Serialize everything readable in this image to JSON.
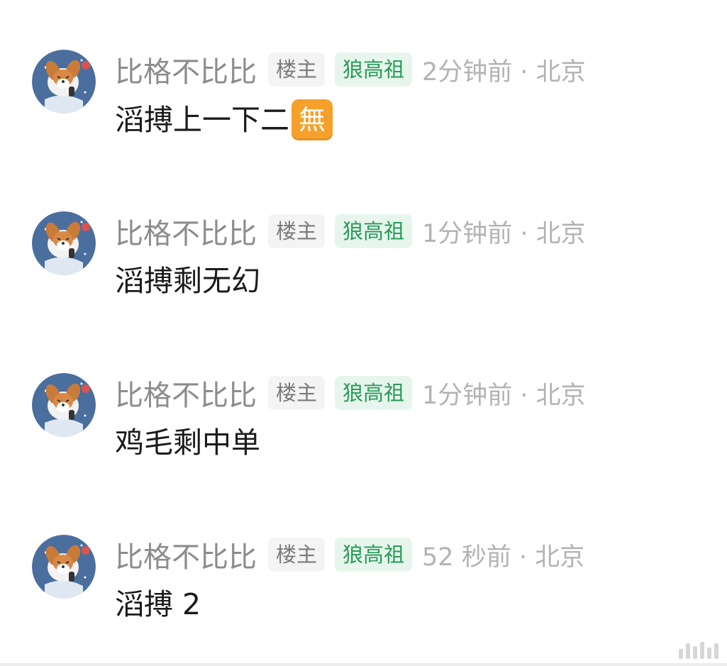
{
  "comments": [
    {
      "username": "比格不比比",
      "badge_op": "楼主",
      "badge_rank": "狼高祖",
      "time": "2分钟前 · 北京",
      "text": "滔搏上一下二",
      "emoji": "無"
    },
    {
      "username": "比格不比比",
      "badge_op": "楼主",
      "badge_rank": "狼高祖",
      "time": "1分钟前 · 北京",
      "text": "滔搏剩无幻"
    },
    {
      "username": "比格不比比",
      "badge_op": "楼主",
      "badge_rank": "狼高祖",
      "time": "1分钟前 · 北京",
      "text": "鸡毛剩中单"
    },
    {
      "username": "比格不比比",
      "badge_op": "楼主",
      "badge_rank": "狼高祖",
      "time": "52 秒前 · 北京",
      "text": "滔搏 2"
    }
  ],
  "colors": {
    "username": "#8c8c8c",
    "op_badge_bg": "#f4f4f4",
    "rank_badge_bg": "#e7f6ec",
    "rank_badge_text": "#2a9a5a",
    "time": "#b3b3b3",
    "text": "#1b1b1b",
    "emoji_bg": "#f5a02a"
  }
}
